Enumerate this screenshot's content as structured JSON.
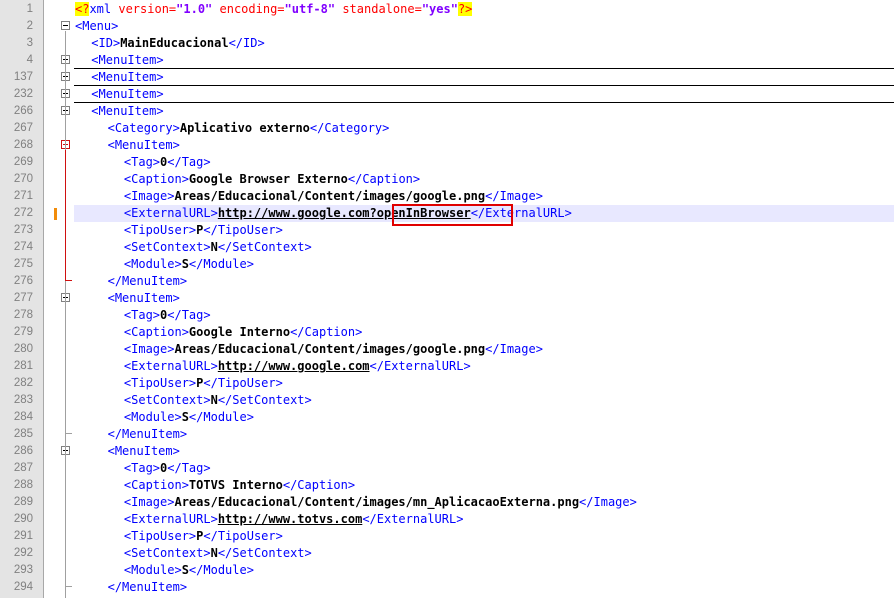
{
  "editor": {
    "language": "xml",
    "current_line": "272",
    "lines": [
      {
        "n": "1",
        "indent": 0,
        "fold": "none",
        "segs": [
          [
            "pi",
            "<?"
          ],
          [
            "tg",
            "xml "
          ],
          [
            "an",
            "version="
          ],
          [
            "av",
            "\"1.0\""
          ],
          [
            "an",
            " encoding="
          ],
          [
            "av",
            "\"utf-8\""
          ],
          [
            "an",
            " standalone="
          ],
          [
            "av",
            "\"yes\""
          ],
          [
            "pi",
            "?>"
          ]
        ]
      },
      {
        "n": "2",
        "indent": 0,
        "fold": "minus",
        "segs": [
          [
            "tg",
            "<Menu>"
          ]
        ]
      },
      {
        "n": "3",
        "indent": 1,
        "fold": "none",
        "segs": [
          [
            "tg",
            "<ID>"
          ],
          [
            "tx",
            "MainEducacional"
          ],
          [
            "tg",
            "</ID>"
          ]
        ]
      },
      {
        "n": "4",
        "indent": 1,
        "fold": "plus",
        "segs": [
          [
            "tg",
            "<MenuItem>"
          ]
        ]
      },
      {
        "n": "137",
        "indent": 1,
        "fold": "plus",
        "segs": [
          [
            "tg",
            "<MenuItem>"
          ]
        ]
      },
      {
        "n": "232",
        "indent": 1,
        "fold": "plus",
        "segs": [
          [
            "tg",
            "<MenuItem>"
          ]
        ]
      },
      {
        "n": "266",
        "indent": 1,
        "fold": "minus",
        "segs": [
          [
            "tg",
            "<MenuItem>"
          ]
        ]
      },
      {
        "n": "267",
        "indent": 2,
        "fold": "none",
        "segs": [
          [
            "tg",
            "<Category>"
          ],
          [
            "tx",
            "Aplicativo externo"
          ],
          [
            "tg",
            "</Category>"
          ]
        ]
      },
      {
        "n": "268",
        "indent": 2,
        "fold": "minus-red",
        "segs": [
          [
            "tg",
            "<MenuItem>"
          ]
        ]
      },
      {
        "n": "269",
        "indent": 3,
        "fold": "none",
        "segs": [
          [
            "tg",
            "<Tag>"
          ],
          [
            "tx",
            "0"
          ],
          [
            "tg",
            "</Tag>"
          ]
        ]
      },
      {
        "n": "270",
        "indent": 3,
        "fold": "none",
        "segs": [
          [
            "tg",
            "<Caption>"
          ],
          [
            "tx",
            "Google Browser Externo"
          ],
          [
            "tg",
            "</Caption>"
          ]
        ]
      },
      {
        "n": "271",
        "indent": 3,
        "fold": "none",
        "segs": [
          [
            "tg",
            "<Image>"
          ],
          [
            "tx",
            "Areas/Educacional/Content/images/google.png"
          ],
          [
            "tg",
            "</Image>"
          ]
        ]
      },
      {
        "n": "272",
        "indent": 3,
        "fold": "none",
        "segs": [
          [
            "tg",
            "<ExternalURL>"
          ],
          [
            "url",
            "http://www.google.com?openInBrowser"
          ],
          [
            "tg",
            "</ExternalURL>"
          ]
        ]
      },
      {
        "n": "273",
        "indent": 3,
        "fold": "none",
        "segs": [
          [
            "tg",
            "<TipoUser>"
          ],
          [
            "tx",
            "P"
          ],
          [
            "tg",
            "</TipoUser>"
          ]
        ]
      },
      {
        "n": "274",
        "indent": 3,
        "fold": "none",
        "segs": [
          [
            "tg",
            "<SetContext>"
          ],
          [
            "tx",
            "N"
          ],
          [
            "tg",
            "</SetContext>"
          ]
        ]
      },
      {
        "n": "275",
        "indent": 3,
        "fold": "none",
        "segs": [
          [
            "tg",
            "<Module>"
          ],
          [
            "tx",
            "S"
          ],
          [
            "tg",
            "</Module>"
          ]
        ]
      },
      {
        "n": "276",
        "indent": 2,
        "fold": "end-red",
        "segs": [
          [
            "tg",
            "</MenuItem>"
          ]
        ]
      },
      {
        "n": "277",
        "indent": 2,
        "fold": "minus",
        "segs": [
          [
            "tg",
            "<MenuItem>"
          ]
        ]
      },
      {
        "n": "278",
        "indent": 3,
        "fold": "none",
        "segs": [
          [
            "tg",
            "<Tag>"
          ],
          [
            "tx",
            "0"
          ],
          [
            "tg",
            "</Tag>"
          ]
        ]
      },
      {
        "n": "279",
        "indent": 3,
        "fold": "none",
        "segs": [
          [
            "tg",
            "<Caption>"
          ],
          [
            "tx",
            "Google Interno"
          ],
          [
            "tg",
            "</Caption>"
          ]
        ]
      },
      {
        "n": "280",
        "indent": 3,
        "fold": "none",
        "segs": [
          [
            "tg",
            "<Image>"
          ],
          [
            "tx",
            "Areas/Educacional/Content/images/google.png"
          ],
          [
            "tg",
            "</Image>"
          ]
        ]
      },
      {
        "n": "281",
        "indent": 3,
        "fold": "none",
        "segs": [
          [
            "tg",
            "<ExternalURL>"
          ],
          [
            "url",
            "http://www.google.com"
          ],
          [
            "tg",
            "</ExternalURL>"
          ]
        ]
      },
      {
        "n": "282",
        "indent": 3,
        "fold": "none",
        "segs": [
          [
            "tg",
            "<TipoUser>"
          ],
          [
            "tx",
            "P"
          ],
          [
            "tg",
            "</TipoUser>"
          ]
        ]
      },
      {
        "n": "283",
        "indent": 3,
        "fold": "none",
        "segs": [
          [
            "tg",
            "<SetContext>"
          ],
          [
            "tx",
            "N"
          ],
          [
            "tg",
            "</SetContext>"
          ]
        ]
      },
      {
        "n": "284",
        "indent": 3,
        "fold": "none",
        "segs": [
          [
            "tg",
            "<Module>"
          ],
          [
            "tx",
            "S"
          ],
          [
            "tg",
            "</Module>"
          ]
        ]
      },
      {
        "n": "285",
        "indent": 2,
        "fold": "end",
        "segs": [
          [
            "tg",
            "</MenuItem>"
          ]
        ]
      },
      {
        "n": "286",
        "indent": 2,
        "fold": "minus",
        "segs": [
          [
            "tg",
            "<MenuItem>"
          ]
        ]
      },
      {
        "n": "287",
        "indent": 3,
        "fold": "none",
        "segs": [
          [
            "tg",
            "<Tag>"
          ],
          [
            "tx",
            "0"
          ],
          [
            "tg",
            "</Tag>"
          ]
        ]
      },
      {
        "n": "288",
        "indent": 3,
        "fold": "none",
        "segs": [
          [
            "tg",
            "<Caption>"
          ],
          [
            "tx",
            "TOTVS Interno"
          ],
          [
            "tg",
            "</Caption>"
          ]
        ]
      },
      {
        "n": "289",
        "indent": 3,
        "fold": "none",
        "segs": [
          [
            "tg",
            "<Image>"
          ],
          [
            "tx",
            "Areas/Educacional/Content/images/mn_AplicacaoExterna.png"
          ],
          [
            "tg",
            "</Image>"
          ]
        ]
      },
      {
        "n": "290",
        "indent": 3,
        "fold": "none",
        "segs": [
          [
            "tg",
            "<ExternalURL>"
          ],
          [
            "url",
            "http://www.totvs.com"
          ],
          [
            "tg",
            "</ExternalURL>"
          ]
        ]
      },
      {
        "n": "291",
        "indent": 3,
        "fold": "none",
        "segs": [
          [
            "tg",
            "<TipoUser>"
          ],
          [
            "tx",
            "P"
          ],
          [
            "tg",
            "</TipoUser>"
          ]
        ]
      },
      {
        "n": "292",
        "indent": 3,
        "fold": "none",
        "segs": [
          [
            "tg",
            "<SetContext>"
          ],
          [
            "tx",
            "N"
          ],
          [
            "tg",
            "</SetContext>"
          ]
        ]
      },
      {
        "n": "293",
        "indent": 3,
        "fold": "none",
        "segs": [
          [
            "tg",
            "<Module>"
          ],
          [
            "tx",
            "S"
          ],
          [
            "tg",
            "</Module>"
          ]
        ]
      },
      {
        "n": "294",
        "indent": 2,
        "fold": "end",
        "segs": [
          [
            "tg",
            "</MenuItem>"
          ]
        ]
      }
    ]
  },
  "annotation": {
    "highlighted_text": "?openInBrowser",
    "color": "#e00000"
  },
  "colors": {
    "tag": "#0000ff",
    "attr_name": "#ff0000",
    "attr_value": "#8000ff",
    "pi_bg": "#ffff00",
    "current_line_bg": "#e8e8ff",
    "change_mark": "#f28c0a",
    "fold_active": "#d01010"
  }
}
